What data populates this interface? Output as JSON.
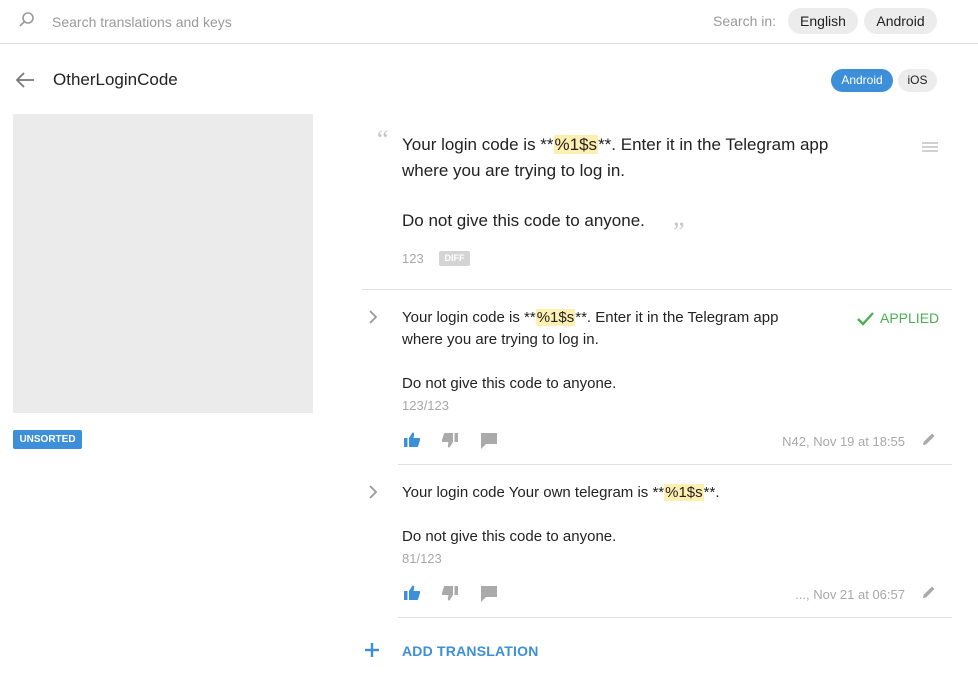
{
  "search": {
    "placeholder": "Search translations and keys"
  },
  "search_in": {
    "label": "Search in:",
    "options": [
      "English",
      "Android"
    ]
  },
  "header": {
    "key": "OtherLoginCode",
    "platforms": [
      "Android",
      "iOS"
    ]
  },
  "sidebar": {
    "badge": "UNSORTED"
  },
  "source": {
    "line1_prefix": "Your login code is **",
    "line1_placeholder": "%1$s",
    "line1_suffix": "**. Enter it in the Telegram app",
    "line2": "where you are trying to log in.",
    "line3": "Do not give this code to anyone.",
    "count": "123",
    "diff_label": "DIFF"
  },
  "translations": [
    {
      "line1_prefix": "Your login code is **",
      "line1_placeholder": "%1$s",
      "line1_suffix": "**. Enter it in the Telegram app",
      "line2": "where you are trying to log in.",
      "line3": "Do not give this code to anyone.",
      "count": "123/123",
      "status": "APPLIED",
      "meta": "N42, Nov 19 at 18:55"
    },
    {
      "line1_prefix": "Your login code Your own telegram is **",
      "line1_placeholder": "%1$s",
      "line1_suffix": "**.",
      "line3": "Do not give this code to anyone.",
      "count": "81/123",
      "meta": "..., Nov 21 at 06:57"
    }
  ],
  "actions": {
    "add_translation": "ADD TRANSLATION"
  },
  "colors": {
    "accent": "#3d8fd9",
    "applied": "#4caf50",
    "highlight": "#fdefb0"
  }
}
